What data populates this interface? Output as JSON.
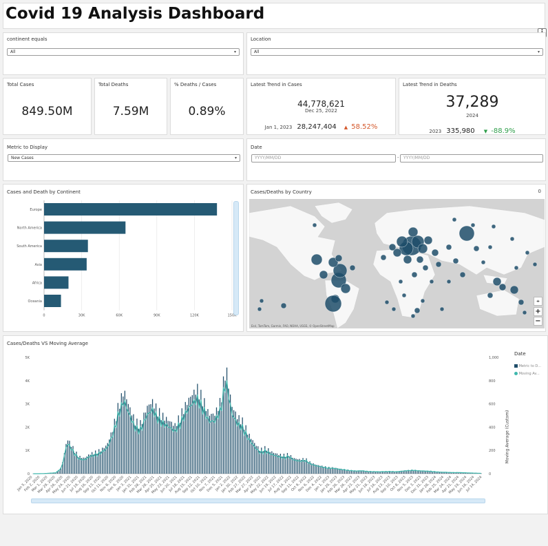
{
  "header": {
    "title": "Covid 19 Analysis Dashboard",
    "menu_icon": "kebab-menu-icon"
  },
  "filters": {
    "continent": {
      "label": "continent equals",
      "value": "All"
    },
    "location": {
      "label": "Location",
      "value": "All"
    }
  },
  "kpis": {
    "total_cases": {
      "label": "Total Cases",
      "value": "849.50M"
    },
    "total_deaths": {
      "label": "Total Deaths",
      "value": "7.59M"
    },
    "pct_deaths": {
      "label": "% Deaths / Cases",
      "value": "0.89%"
    }
  },
  "trend_cases": {
    "label": "Latest Trend in Cases",
    "value": "44,778,621",
    "date": "Dec 25, 2022",
    "prev_label": "Jan 1, 2023",
    "prev_value": "28,247,404",
    "change": "58.52%",
    "change_color": "#d4572a"
  },
  "trend_deaths": {
    "label": "Latest Trend in Deaths",
    "value": "37,289",
    "date": "2024",
    "prev_label": "2023",
    "prev_value": "335,980",
    "change": "-88.9%",
    "change_color": "#2e9e4a"
  },
  "metric": {
    "label": "Metric to Display",
    "value": "New Cases"
  },
  "date_filter": {
    "label": "Date",
    "from_placeholder": "YYYY/MM/DD",
    "to_placeholder": "YYYY/MM/DD",
    "separator": "-"
  },
  "continent_chart": {
    "title": "Cases and Death by Continent",
    "bar_color": "#255a74"
  },
  "map": {
    "title": "Cases/Deaths by Country",
    "corner_value": "0",
    "attribution": "Esri, TomTom, Garmin, FAO, NOAA, USGS, © OpenStreetMap",
    "zoom_in": "+",
    "zoom_out": "−",
    "locate_icon": "locate-icon"
  },
  "moving_avg_chart": {
    "title": "Cases/Deaths VS Moving Average",
    "y2_label": "Moving Average (Custom)",
    "legend_title": "Date",
    "legend": [
      {
        "label": "Metric to D...",
        "color": "#1f4e6a"
      },
      {
        "label": "Moving Av...",
        "color": "#3fb8ad"
      }
    ]
  },
  "chart_data": [
    {
      "type": "bar",
      "orientation": "horizontal",
      "categories": [
        "Europe",
        "North America",
        "South America",
        "Asia",
        "Africa",
        "Oceania"
      ],
      "values": [
        138000,
        65000,
        35000,
        34000,
        19500,
        13500
      ],
      "xlim": [
        0,
        150000
      ],
      "xticks": [
        "0",
        "30K",
        "60K",
        "90K",
        "120K",
        "150K"
      ],
      "grid": true
    },
    {
      "type": "bar",
      "overlay": "line",
      "y_ticks": [
        "0",
        "1K",
        "2K",
        "3K",
        "4K",
        "5K"
      ],
      "y2_ticks": [
        "0",
        "200",
        "400",
        "600",
        "800",
        "1,000"
      ],
      "ylim": [
        0,
        5000
      ],
      "y2lim": [
        0,
        1000
      ],
      "x_labels": [
        "Jan 5, 2020",
        "Feb 2, 2020",
        "Mar 1, 2020",
        "Mar 29, 2020",
        "Apr 26, 2020",
        "May 24, 2020",
        "Jun 21, 2020",
        "Jul 19, 2020",
        "Aug 16, 2020",
        "Sep 13, 2020",
        "Oct 11, 2020",
        "Nov 8, 2020",
        "Dec 6, 2020",
        "Jan 3, 2021",
        "Jan 31, 2021",
        "Feb 28, 2021",
        "Mar 28, 2021",
        "Apr 25, 2021",
        "May 23, 2021",
        "Jun 20, 2021",
        "Jul 18, 2021",
        "Aug 15, 2021",
        "Sep 12, 2021",
        "Oct 10, 2021",
        "Nov 7, 2021",
        "Dec 5, 2021",
        "Jan 2, 2022",
        "Jan 30, 2022",
        "Feb 27, 2022",
        "Mar 27, 2022",
        "Apr 24, 2022",
        "May 22, 2022",
        "Jun 19, 2022",
        "Jul 17, 2022",
        "Aug 14, 2022",
        "Sep 11, 2022",
        "Oct 9, 2022",
        "Nov 6, 2022",
        "Dec 4, 2022",
        "Jan 1, 2023",
        "Jan 29, 2023",
        "Feb 26, 2023",
        "Mar 26, 2023",
        "Apr 23, 2023",
        "May 21, 2023",
        "Jun 18, 2023",
        "Jul 16, 2023",
        "Aug 13, 2023",
        "Sep 10, 2023",
        "Oct 8, 2023",
        "Nov 5, 2023",
        "Dec 3, 2023",
        "Dec 31, 2023",
        "Jan 28, 2024",
        "Feb 25, 2024",
        "Mar 24, 2024",
        "Apr 21, 2024",
        "May 19, 2024",
        "Jun 16, 2024",
        "Jul 14, 2024"
      ],
      "profile": [
        0,
        0,
        10,
        30,
        50,
        300,
        1600,
        1200,
        800,
        700,
        900,
        1000,
        1100,
        1300,
        2000,
        3100,
        3800,
        3000,
        2400,
        2300,
        3000,
        3300,
        2900,
        2600,
        2400,
        2200,
        2700,
        3200,
        3600,
        3900,
        3400,
        2700,
        2700,
        3300,
        4900,
        3100,
        2600,
        2400,
        1800,
        1400,
        1100,
        1200,
        1000,
        900,
        850,
        900,
        700,
        650,
        700,
        500,
        400,
        350,
        300,
        280,
        230,
        200,
        160,
        140,
        150,
        120,
        110,
        100,
        110,
        120,
        100,
        130,
        160,
        180,
        150,
        140,
        130,
        100,
        80,
        70,
        60,
        60,
        50,
        40,
        30,
        20
      ]
    }
  ]
}
